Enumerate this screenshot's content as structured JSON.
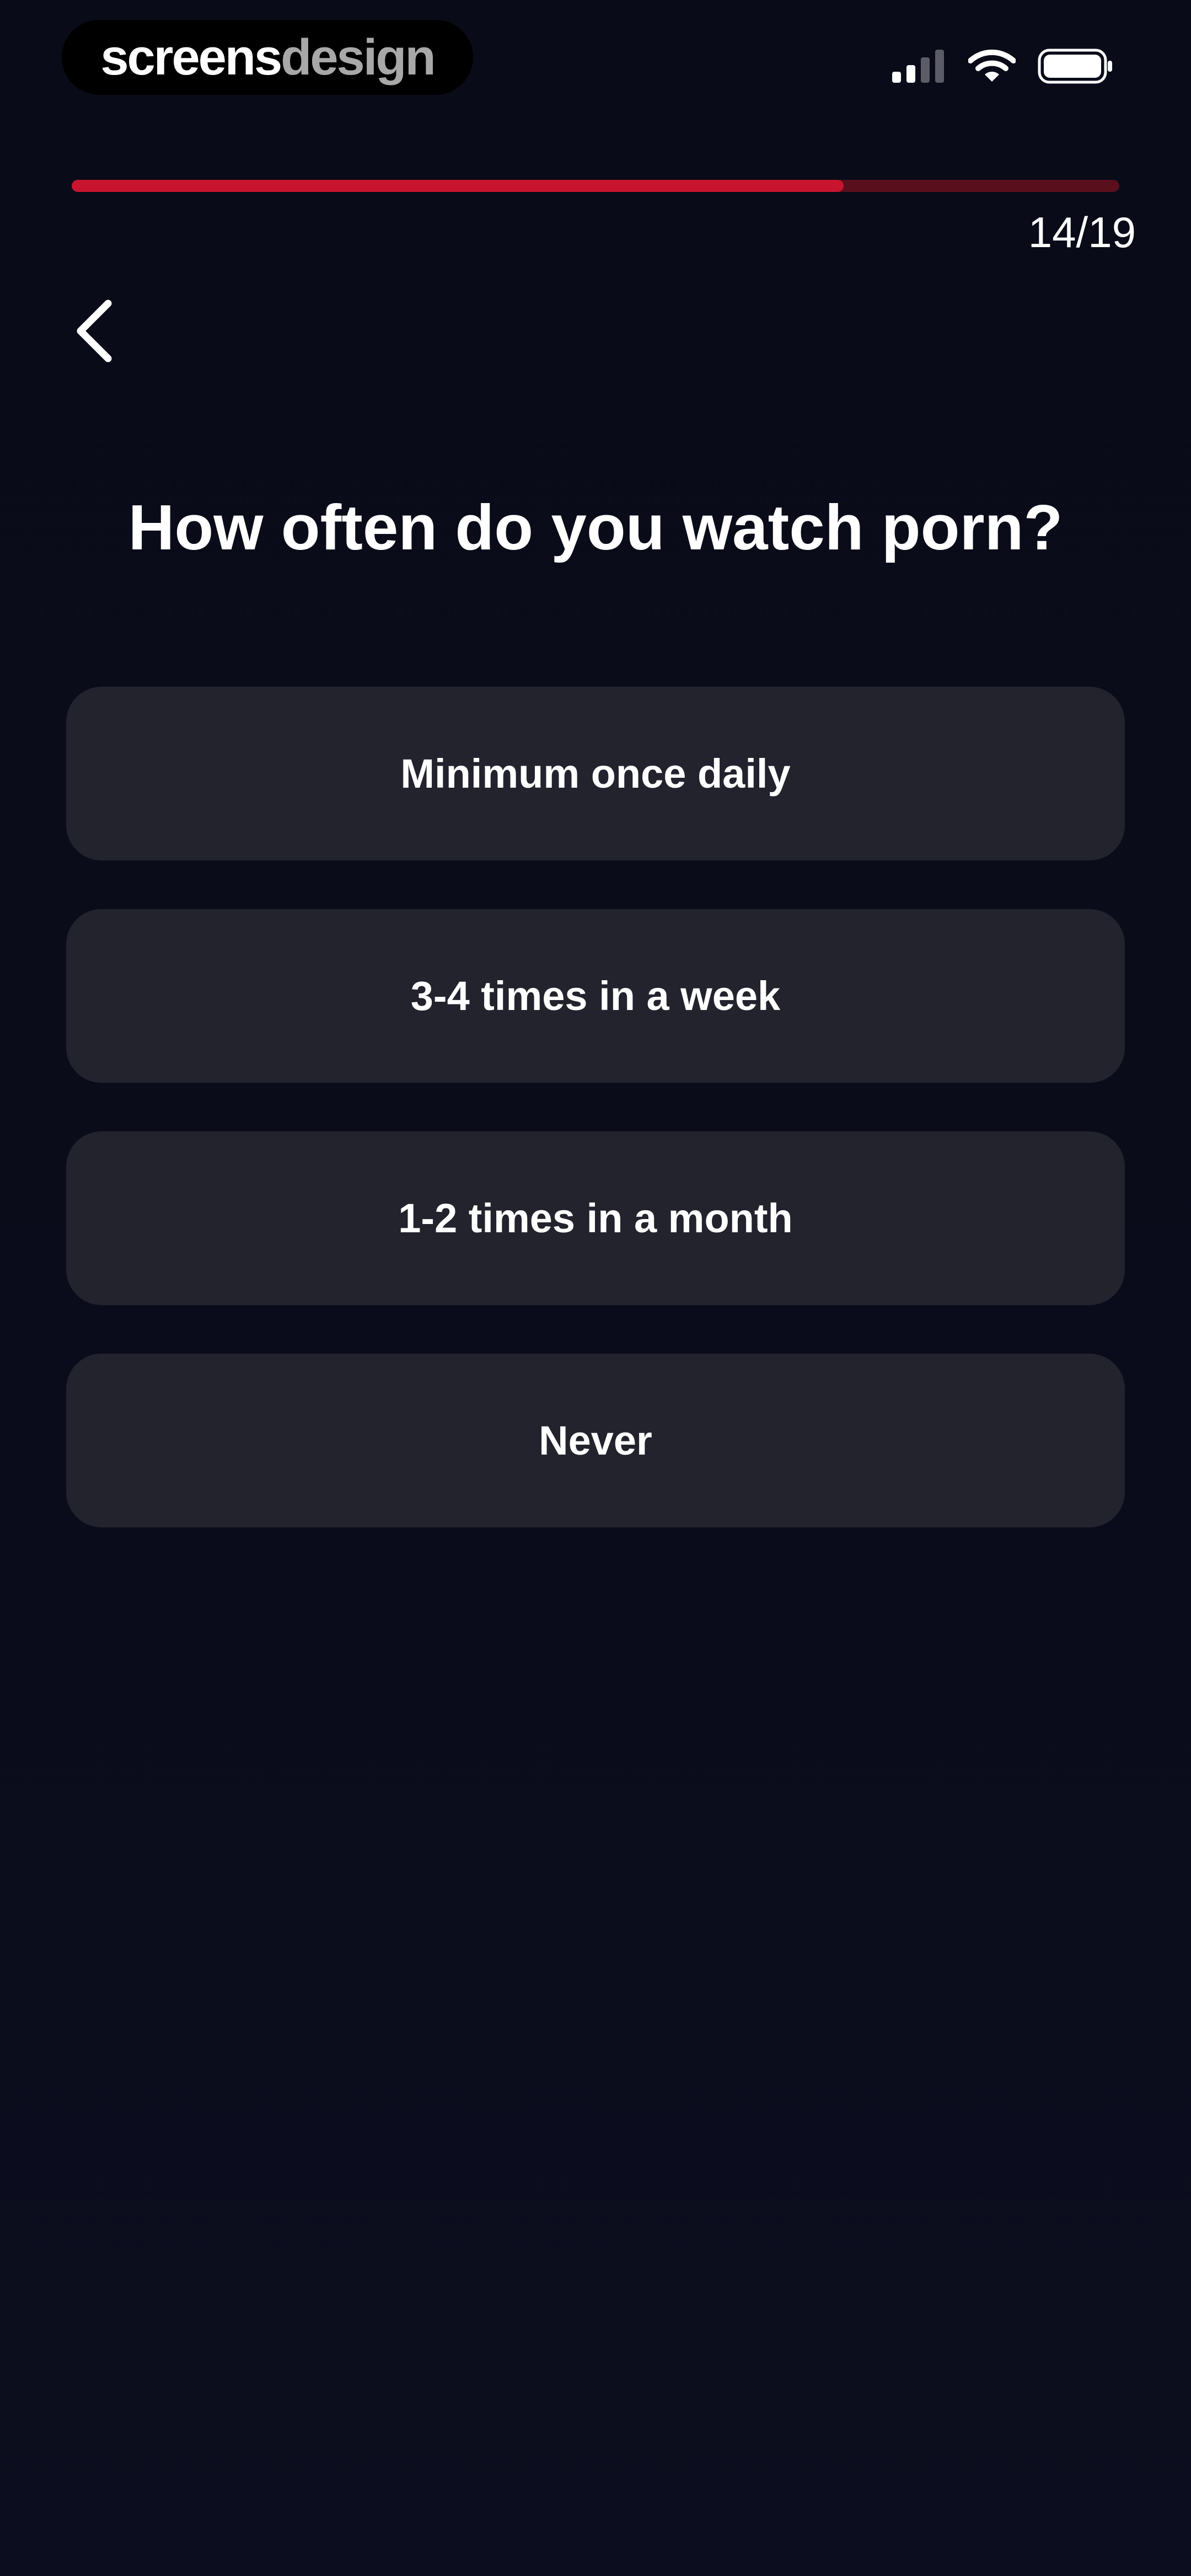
{
  "watermark": {
    "part1": "screens",
    "part2": "design"
  },
  "status_bar": {
    "icons": [
      "signal-icon",
      "wifi-icon",
      "battery-icon"
    ]
  },
  "progress": {
    "current": 14,
    "total": 19,
    "label": "14/19",
    "fill_color": "#c8142e",
    "track_color": "#5a0f1d"
  },
  "navigation": {
    "back_icon": "chevron-left-icon"
  },
  "question": {
    "text": "How often do you watch porn?"
  },
  "options": [
    {
      "label": "Minimum once daily"
    },
    {
      "label": "3-4 times in a week"
    },
    {
      "label": "1-2 times in a month"
    },
    {
      "label": "Never"
    }
  ],
  "colors": {
    "background": "#0a0c1a",
    "option_background": "#22232d",
    "accent": "#c8142e"
  }
}
